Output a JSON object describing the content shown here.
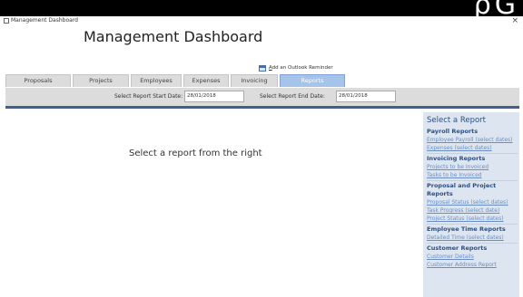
{
  "window": {
    "title": "Management Dashboard",
    "heading": "Management Dashboard"
  },
  "reminder": {
    "label": "Add an Outlook Reminder"
  },
  "tabs": [
    {
      "label": "Proposals"
    },
    {
      "label": "Projects"
    },
    {
      "label": "Employees"
    },
    {
      "label": "Expenses"
    },
    {
      "label": "Invoicing"
    },
    {
      "label": "Reports",
      "active": true
    }
  ],
  "filters": {
    "start_label": "Select Report Start Date:",
    "start_value": "28/01/2018",
    "end_label": "Select Report End Date:",
    "end_value": "28/01/2018"
  },
  "main": {
    "message": "Select a report from the right"
  },
  "report_panel": {
    "title": "Select a Report",
    "sections": [
      {
        "heading": "Payroll Reports",
        "items": [
          "Employee Payroll (select dates)",
          "Expenses (select dates)"
        ]
      },
      {
        "heading": "Invoicing Reports",
        "items": [
          "Projects to be Invoiced",
          "Tasks to be Invoiced"
        ]
      },
      {
        "heading": "Proposal and Project Reports",
        "items": [
          "Proposal Status (select dates)",
          "Task Progress (select date)",
          "Project Status (select dates)"
        ]
      },
      {
        "heading": "Employee Time Reports",
        "items": [
          "Detailed Time (select dates)"
        ]
      },
      {
        "heading": "Customer Reports",
        "items": [
          "Customer Details",
          "Customer Address Report"
        ]
      }
    ]
  },
  "colors": {
    "active_tab": "#a6c3ea",
    "divider": "#3e5f8f",
    "panel_bg": "#dde5f0",
    "panel_heading": "#2f4f7f",
    "link": "#6a8ec4"
  }
}
